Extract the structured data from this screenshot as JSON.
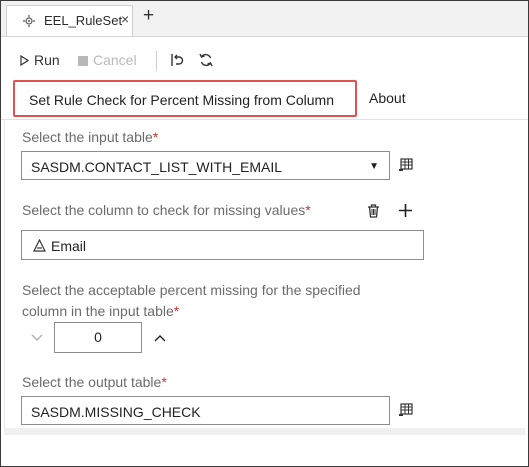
{
  "tab": {
    "title": "EEL_RuleSet",
    "close_glyph": "×",
    "add_glyph": "+"
  },
  "toolbar": {
    "run_label": "Run",
    "cancel_label": "Cancel"
  },
  "inner_tabs": {
    "active": "Set Rule Check for Percent Missing from Column",
    "about": "About"
  },
  "form": {
    "input_table_label": "Select the input table",
    "input_table_value": "SASDM.CONTACT_LIST_WITH_EMAIL",
    "column_label": "Select the column to check for missing values",
    "column_value": "Email",
    "percent_label_line1": "Select the acceptable percent missing for the specified",
    "percent_label_line2": "column in the input table",
    "percent_value": "0",
    "output_table_label": "Select the output table",
    "output_table_value": "SASDM.MISSING_CHECK",
    "required_marker": "*"
  },
  "colors": {
    "highlight": "#e05252",
    "required": "#d32f2f"
  },
  "icons": [
    "settings-flow-icon",
    "play-icon",
    "stop-icon",
    "undo-icon",
    "refresh-icon",
    "table-browse-icon",
    "trash-icon",
    "plus-icon",
    "character-column-icon",
    "chevron-down-icon",
    "chevron-up-icon"
  ]
}
